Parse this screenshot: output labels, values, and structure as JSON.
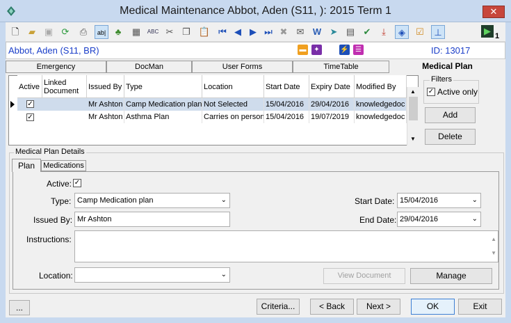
{
  "window": {
    "title": "Medical Maintenance   Abbot, Aden (S11, ): 2015 Term 1",
    "close_label": "✕"
  },
  "toolbar": {
    "badge": "1"
  },
  "infobar": {
    "student": "Abbot, Aden (S11, BR)",
    "id_label": "ID: 13017"
  },
  "tabs": [
    {
      "label": "Emergency"
    },
    {
      "label": "DocMan"
    },
    {
      "label": "User Forms"
    },
    {
      "label": "TimeTable"
    },
    {
      "label": "Medical Plan"
    }
  ],
  "grid": {
    "columns": [
      "Active",
      "Linked Document",
      "Issued By",
      "Type",
      "Location",
      "Start Date",
      "Expiry Date",
      "Modified By"
    ],
    "rows": [
      {
        "active": true,
        "linked": "",
        "issued_by": "Mr Ashton",
        "type": "Camp Medication plan",
        "location": "Not Selected",
        "start": "15/04/2016",
        "expiry": "29/04/2016",
        "modified_by": "knowledgedoc"
      },
      {
        "active": true,
        "linked": "",
        "issued_by": "Mr Ashton",
        "type": "Asthma Plan",
        "location": "Carries on person",
        "start": "15/04/2016",
        "expiry": "19/07/2019",
        "modified_by": "knowledgedoc"
      }
    ]
  },
  "filters": {
    "group_label": "Filters",
    "active_only_label": "Active only",
    "active_only_checked": true
  },
  "side_buttons": {
    "add": "Add",
    "delete": "Delete"
  },
  "details": {
    "group_label": "Medical Plan Details",
    "subtabs": [
      "Plan",
      "Medications"
    ],
    "active_label": "Active:",
    "type_label": "Type:",
    "type_value": "Camp Medication plan",
    "issued_by_label": "Issued By:",
    "issued_by_value": "Mr Ashton",
    "start_date_label": "Start Date:",
    "start_date_value": "15/04/2016",
    "end_date_label": "End Date:",
    "end_date_value": "29/04/2016",
    "instructions_label": "Instructions:",
    "instructions_value": "",
    "location_label": "Location:",
    "location_value": "",
    "view_document": "View Document",
    "manage": "Manage"
  },
  "bottom": {
    "more": "...",
    "criteria": "Criteria...",
    "back": "< Back",
    "next": "Next >",
    "ok": "OK",
    "exit": "Exit"
  },
  "colors": {
    "title_bar": "#c8d9ef",
    "info_text": "#1a3ec9",
    "selected_row": "#cfdcec"
  }
}
